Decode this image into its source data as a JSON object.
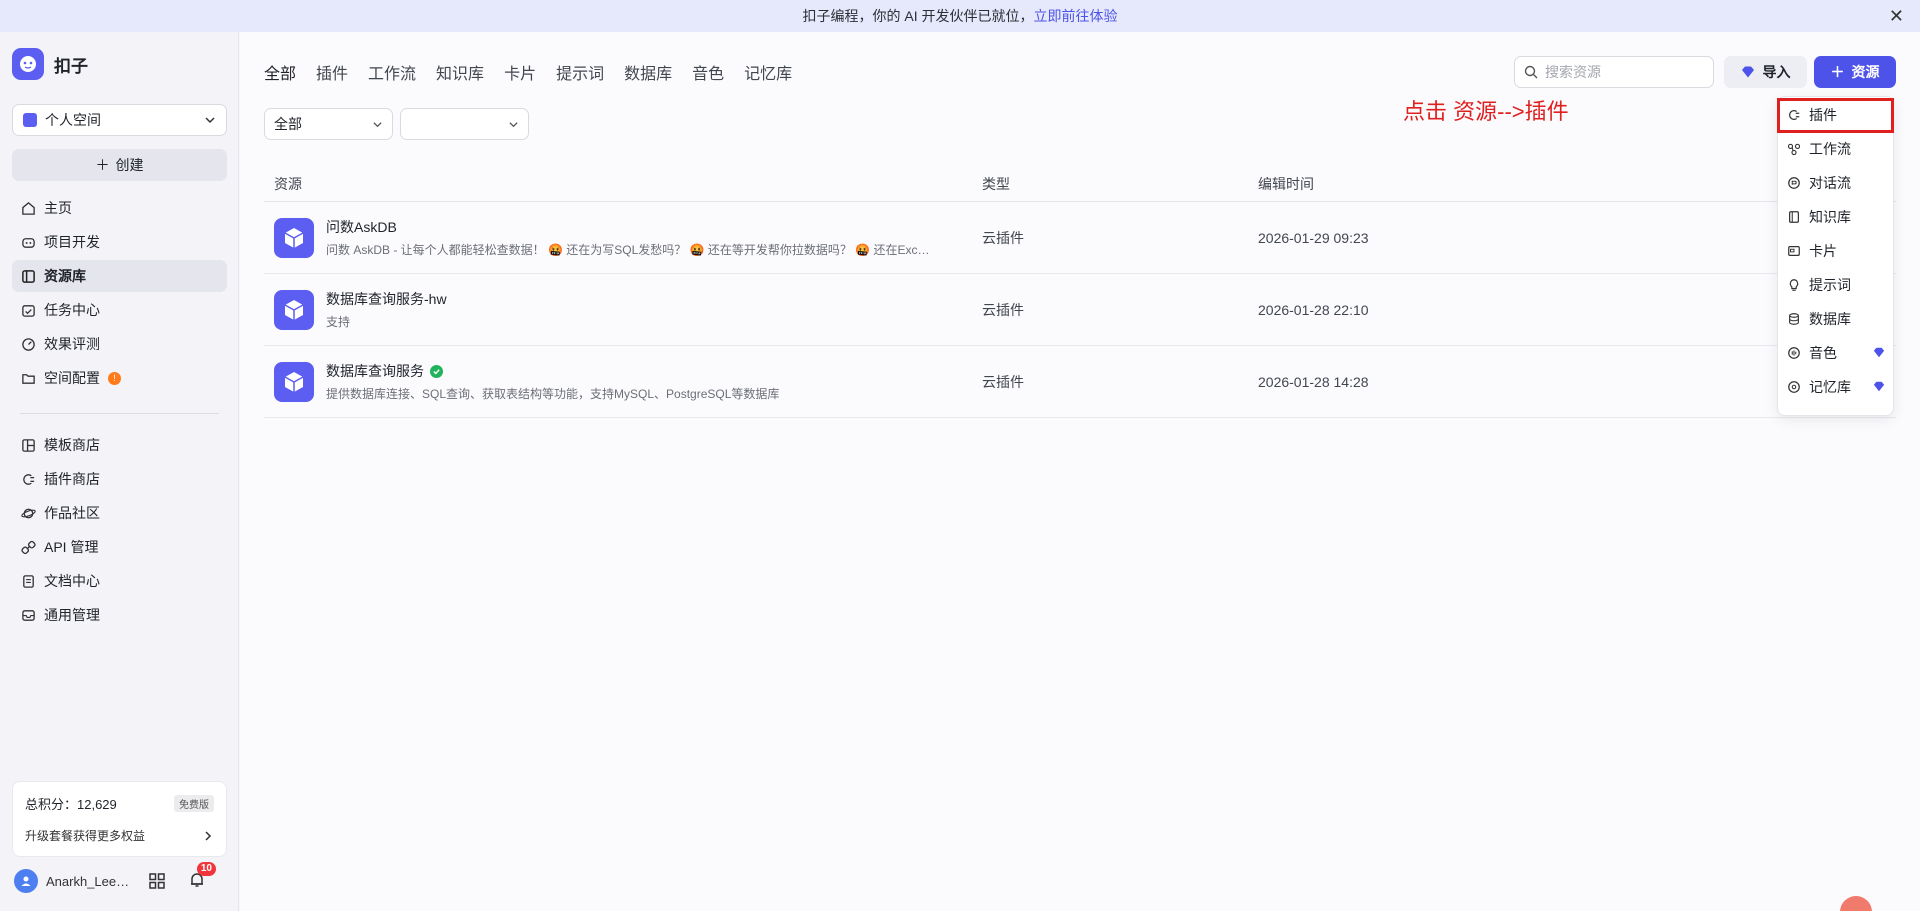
{
  "banner": {
    "text": "扣子编程，你的 AI 开发伙伴已就位，",
    "link": "立即前往体验"
  },
  "brand": {
    "name": "扣子"
  },
  "space": {
    "label": "个人空间"
  },
  "create_label": "创建",
  "nav_main": [
    {
      "label": "主页",
      "icon": "home-icon"
    },
    {
      "label": "项目开发",
      "icon": "bot-icon"
    },
    {
      "label": "资源库",
      "icon": "library-icon",
      "active": true
    },
    {
      "label": "任务中心",
      "icon": "task-icon"
    },
    {
      "label": "效果评测",
      "icon": "gauge-icon"
    },
    {
      "label": "空间配置",
      "icon": "folder-settings-icon",
      "badge": "!"
    }
  ],
  "nav_secondary": [
    {
      "label": "模板商店",
      "icon": "template-icon"
    },
    {
      "label": "插件商店",
      "icon": "plugin-icon"
    },
    {
      "label": "作品社区",
      "icon": "planet-icon"
    },
    {
      "label": "API 管理",
      "icon": "link-icon"
    },
    {
      "label": "文档中心",
      "icon": "doc-icon"
    },
    {
      "label": "通用管理",
      "icon": "inbox-icon"
    }
  ],
  "credits": {
    "label": "总积分：12,629",
    "plan": "免费版",
    "upgrade": "升级套餐获得更多权益"
  },
  "user": {
    "name": "Anarkh_Lee@…",
    "notifications": "10"
  },
  "tabs": [
    "全部",
    "插件",
    "工作流",
    "知识库",
    "卡片",
    "提示词",
    "数据库",
    "音色",
    "记忆库"
  ],
  "search": {
    "placeholder": "搜索资源"
  },
  "buttons": {
    "import": "导入",
    "add": "资源"
  },
  "filters": {
    "type_value": "全部",
    "second_value": ""
  },
  "table": {
    "headers": {
      "resource": "资源",
      "type": "类型",
      "time": "编辑时间"
    },
    "rows": [
      {
        "title": "问数AskDB",
        "desc": "问数 AskDB - 让每个人都能轻松查数据！ 🤬 还在为写SQL发愁吗？ 🤬 还在等开发帮你拉数据吗？ 🤬 还在Excel里痛苦地做分析吗？",
        "type": "云插件",
        "time": "2026-01-29 09:23",
        "verified": false
      },
      {
        "title": "数据库查询服务-hw",
        "desc": "支持",
        "type": "云插件",
        "time": "2026-01-28 22:10",
        "verified": false
      },
      {
        "title": "数据库查询服务",
        "desc": "提供数据库连接、SQL查询、获取表结构等功能，支持MySQL、PostgreSQL等数据库",
        "type": "云插件",
        "time": "2026-01-28 14:28",
        "verified": true
      }
    ]
  },
  "annotation": "点击 资源-->插件",
  "dropdown": [
    {
      "label": "插件",
      "icon": "plugin-icon"
    },
    {
      "label": "工作流",
      "icon": "workflow-icon"
    },
    {
      "label": "对话流",
      "icon": "chatflow-icon"
    },
    {
      "label": "知识库",
      "icon": "knowledge-icon"
    },
    {
      "label": "卡片",
      "icon": "card-icon"
    },
    {
      "label": "提示词",
      "icon": "prompt-icon"
    },
    {
      "label": "数据库",
      "icon": "database-icon"
    },
    {
      "label": "音色",
      "icon": "voice-icon",
      "vip": true
    },
    {
      "label": "记忆库",
      "icon": "memory-icon",
      "vip": true
    }
  ],
  "colors": {
    "accent": "#4d53e8",
    "annotation": "#e0201f",
    "success": "#21b35b",
    "badge": "#f0353b"
  }
}
